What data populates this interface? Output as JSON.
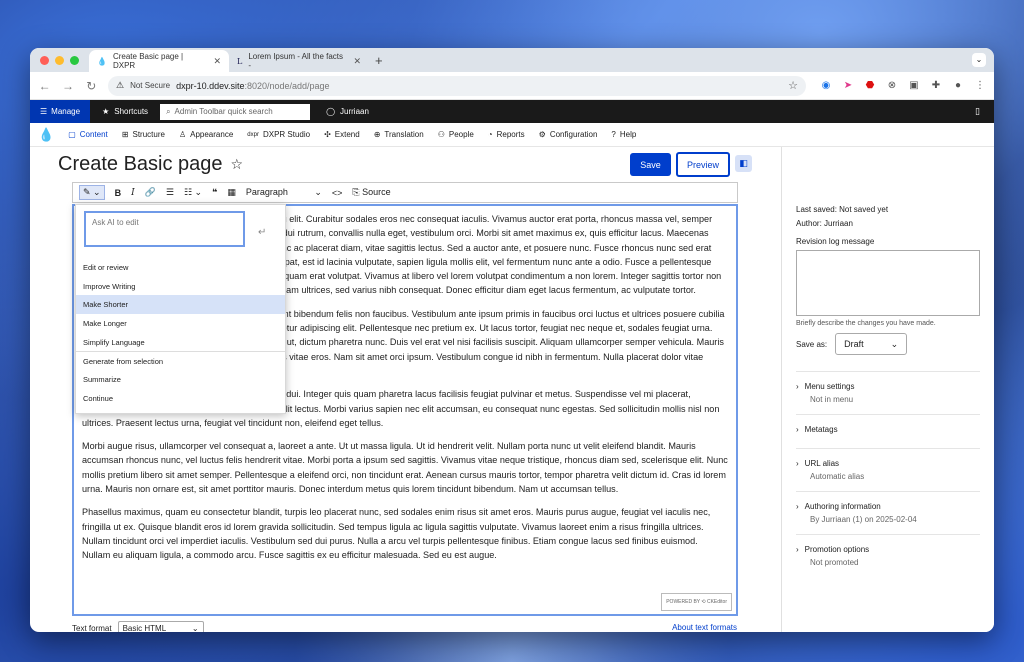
{
  "browser": {
    "tabs": [
      {
        "title": "Create Basic page | DXPR",
        "active": true
      },
      {
        "title": "Lorem Ipsum - All the facts -",
        "active": false
      }
    ],
    "not_secure": "Not Secure",
    "url_host": "dxpr-10.ddev.site",
    "url_rest": ":8020/node/add/page"
  },
  "toolbar": {
    "manage": "Manage",
    "shortcuts": "Shortcuts",
    "search_placeholder": "Admin Toolbar quick search",
    "user": "Jurriaan"
  },
  "menu": {
    "items": [
      "Content",
      "Structure",
      "Appearance",
      "DXPR Studio",
      "Extend",
      "Translation",
      "People",
      "Reports",
      "Configuration",
      "Help"
    ]
  },
  "page": {
    "title": "Create Basic page",
    "save": "Save",
    "preview": "Preview"
  },
  "editor": {
    "paragraph": "Paragraph",
    "source": "Source",
    "badge": "POWERED BY ⟲ CKEditor",
    "text_format_label": "Text format",
    "text_format_value": "Basic HTML",
    "about_formats": "About text formats",
    "paragraphs": [
      "Lorem ipsum dolor sit amet, consectetur adipiscing elit. Curabitur sodales eros nec consequat iaculis. Vivamus auctor erat porta, rhoncus massa vel, semper diam. Suspendisse ultrices tincidunt nibh. Nam in dui rutrum, convallis nulla eget, vestibulum orci. Morbi sit amet maximus ex, quis efficitur lacus. Maecenas faucibus egestas porta, fermentum tempor ex. Nunc ac placerat diam, vitae sagittis lectus. Sed a auctor ante, et posuere nunc. Fusce rhoncus nunc sed erat pulvinar imperdiet, vulputate at erat. Quisque volutpat, est id lacinia vulputate, sapien ligula mollis elit, vel fermentum nunc ante a odio. Fusce a pellentesque justo, ac augue, a convallis mi lobortis sit amet. Aliquam erat volutpat. Vivamus at libero vel lorem volutpat condimentum a non lorem. Integer sagittis tortor non mauris lobortis sit at. Aliquam fermentum urna id diam ultrices, sed varius nibh consequat. Donec efficitur diam eget lacus fermentum, ac vulputate tortor.",
      "Nulla facilisi. Vestibulum sagittis metus sed tincidunt bibendum felis non faucibus. Vestibulum ante ipsum primis in faucibus orci luctus et ultrices posuere cubilia curae. Aenean elementum dolor sit amet, consectetur adipiscing elit. Pellentesque nec pretium ex. Ut lacus tortor, feugiat nec neque et, sodales feugiat urna. Nulla ullamcorper magna eget faucibus vel magna ut, dictum pharetra nunc. Duis vel erat vel nisi facilisis suscipit. Aliquam ullamcorper semper vehicula. Mauris pharetra dictum volutpat ligula, eu finibus mi metus vitae eros. Nam sit amet orci ipsum. Vestibulum congue id nibh in fermentum. Nulla placerat dolor vitae accumsan sit amet scelerisque.",
      "Maecenas at dolor eget sapien mollis feugiat ac id dui. Integer quis quam pharetra lacus facilisis feugiat pulvinar et metus. Suspendisse vel mi placerat, sollicitudin urna eu, fermentum felis. Fusce quis velit lectus. Morbi varius sapien nec elit accumsan, eu consequat nunc egestas. Sed sollicitudin mollis nisl non ultrices. Praesent lectus urna, feugiat vel tincidunt non, eleifend eget tellus.",
      "Morbi augue risus, ullamcorper vel consequat a, laoreet a ante. Ut ut massa ligula. Ut id hendrerit velit. Nullam porta nunc ut velit eleifend blandit. Mauris accumsan rhoncus nunc, vel luctus felis hendrerit vitae. Morbi porta a ipsum sed sagittis. Vivamus vitae neque tristique, rhoncus diam sed, scelerisque elit. Nunc mollis pretium libero sit amet semper. Pellentesque a eleifend orci, non tincidunt erat. Aenean cursus mauris tortor, tempor pharetra velit dictum id. Cras id lorem urna. Mauris non ornare est, sit amet porttitor mauris. Donec interdum metus quis lorem tincidunt bibendum. Nam ut accumsan tellus.",
      "Phasellus maximus, quam eu consectetur blandit, turpis leo placerat nunc, sed sodales enim risus sit amet eros. Mauris purus augue, feugiat vel iaculis nec, fringilla ut ex. Quisque blandit eros id lorem gravida sollicitudin. Sed tempus ligula ac ligula sagittis vulputate. Vivamus laoreet enim a risus fringilla ultrices. Nullam tincidunt orci vel imperdiet iaculis. Vestibulum sed dui purus. Nulla a arcu vel turpis pellentesque finibus. Etiam congue lacus sed finibus euismod. Nullam eu aliquam ligula, a commodo arcu. Fusce sagittis ex eu efficitur malesuada. Sed eu est augue."
    ]
  },
  "ai": {
    "placeholder": "Ask AI to edit",
    "items": [
      "Edit or review",
      "Improve Writing",
      "Make Shorter",
      "Make Longer",
      "Simplify Language",
      "Generate from selection",
      "Summarize",
      "Continue"
    ],
    "highlighted": "Make Shorter"
  },
  "sidebar": {
    "last_saved": "Last saved: Not saved yet",
    "author": "Author: Jurriaan",
    "revision_label": "Revision log message",
    "revision_hint": "Briefly describe the changes you have made.",
    "save_as_label": "Save as:",
    "save_as_value": "Draft",
    "sections": [
      {
        "title": "Menu settings",
        "summary": "Not in menu"
      },
      {
        "title": "Metatags",
        "summary": ""
      },
      {
        "title": "URL alias",
        "summary": "Automatic alias"
      },
      {
        "title": "Authoring information",
        "summary": "By Jurriaan (1) on 2025-02-04"
      },
      {
        "title": "Promotion options",
        "summary": "Not promoted"
      }
    ]
  },
  "colors": {
    "accent": "#003ecc",
    "toolbar": "#1a1a1a",
    "manage": "#0036b1"
  }
}
